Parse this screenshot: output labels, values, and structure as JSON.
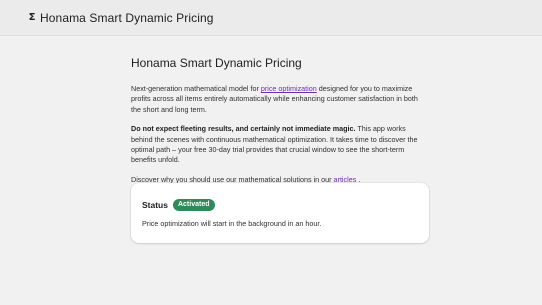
{
  "topbar": {
    "logo_glyph": "Σ",
    "app_title": "Honama Smart Dynamic Pricing"
  },
  "main": {
    "heading": "Honama Smart Dynamic Pricing",
    "intro": {
      "before_link": "Next-generation mathematical model for ",
      "link_text": "price optimization",
      "after_link": " designed for you to maximize profits across all items entirely automatically while enhancing customer satisfaction in both the short and long term."
    },
    "notice": {
      "bold": "Do not expect fleeting results, and certainly not immediate magic.",
      "rest": " This app works behind the scenes with continuous mathematical optimization. It takes time to discover the optimal path – your free 30-day trial provides that crucial window to see the short-term benefits unfold."
    },
    "discover": {
      "before_link": "Discover why you should use our mathematical solutions in our ",
      "link_text": "articles",
      "after_link": " ."
    }
  },
  "status_card": {
    "label": "Status",
    "badge": "Activated",
    "badge_color": "#2f8a5a",
    "description": "Price optimization will start in the background in an hour."
  }
}
